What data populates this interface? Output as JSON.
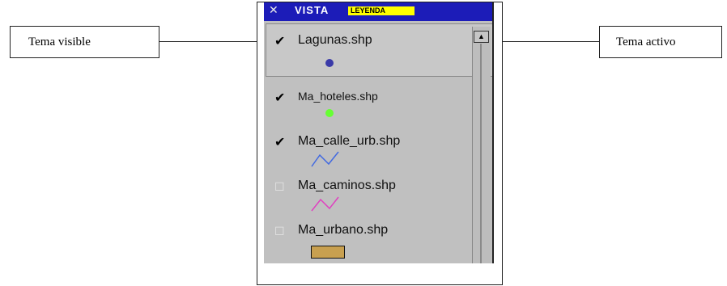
{
  "callouts": {
    "left": "Tema visible",
    "right": "Tema activo"
  },
  "window": {
    "title": "VISTA",
    "highlight_text": "LEYENDA"
  },
  "layers": [
    {
      "name": "Lagunas.shp",
      "visible": true,
      "active": true,
      "symbol": "point",
      "color": "#3a3aa8"
    },
    {
      "name": "Ma_hoteles.shp",
      "visible": true,
      "active": false,
      "symbol": "point",
      "color": "#66ff33"
    },
    {
      "name": "Ma_calle_urb.shp",
      "visible": true,
      "active": false,
      "symbol": "line",
      "color": "#4169e1"
    },
    {
      "name": "Ma_caminos.shp",
      "visible": false,
      "active": false,
      "symbol": "line",
      "color": "#e040c0"
    },
    {
      "name": "Ma_urbano.shp",
      "visible": false,
      "active": false,
      "symbol": "polygon",
      "color": "#c8a050"
    }
  ],
  "icons": {
    "checked": "checkmark-icon",
    "unchecked": "empty-checkbox-icon",
    "scroll_up": "scroll-up-arrow-icon"
  }
}
